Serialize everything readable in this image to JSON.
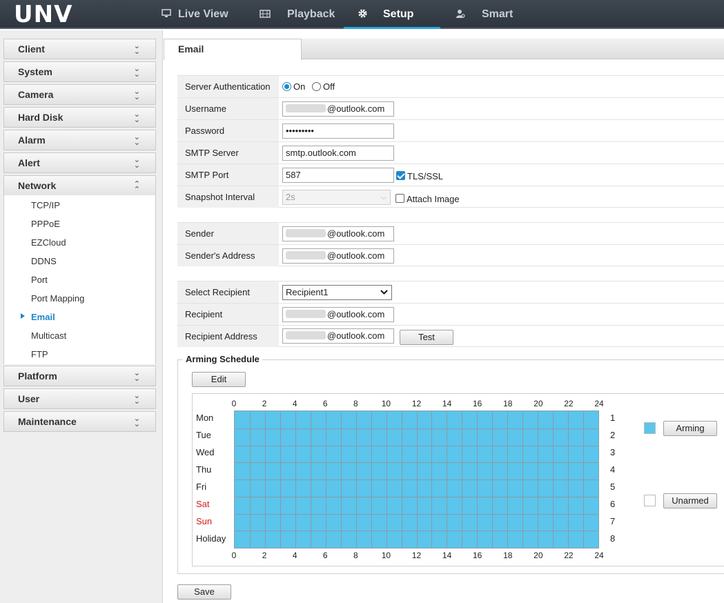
{
  "brand": {
    "logo_text": "UNV"
  },
  "topnav": {
    "tabs": [
      {
        "label": "Live View",
        "icon": "monitor-icon"
      },
      {
        "label": "Playback",
        "icon": "film-icon"
      },
      {
        "label": "Setup",
        "icon": "gear-icon",
        "active": true
      },
      {
        "label": "Smart",
        "icon": "person-search-icon"
      }
    ]
  },
  "sidebar": {
    "groups": [
      {
        "label": "Client"
      },
      {
        "label": "System"
      },
      {
        "label": "Camera"
      },
      {
        "label": "Hard Disk"
      },
      {
        "label": "Alarm"
      },
      {
        "label": "Alert"
      },
      {
        "label": "Network",
        "expanded": true
      },
      {
        "label": "Platform"
      },
      {
        "label": "User"
      },
      {
        "label": "Maintenance"
      }
    ],
    "network_items": [
      "TCP/IP",
      "PPPoE",
      "EZCloud",
      "DDNS",
      "Port",
      "Port Mapping",
      "Email",
      "Multicast",
      "FTP"
    ],
    "active_item": "Email"
  },
  "page": {
    "tab_title": "Email"
  },
  "form": {
    "server_auth": {
      "label": "Server Authentication",
      "on_label": "On",
      "off_label": "Off",
      "value": "On"
    },
    "username": {
      "label": "Username",
      "value_suffix": "@outlook.com"
    },
    "password": {
      "label": "Password",
      "value": "•••••••••"
    },
    "smtp_server": {
      "label": "SMTP Server",
      "value": "smtp.outlook.com"
    },
    "smtp_port": {
      "label": "SMTP Port",
      "value": "587"
    },
    "tls": {
      "label": "TLS/SSL",
      "checked": true
    },
    "snapshot_interval": {
      "label": "Snapshot Interval",
      "value": "2s",
      "disabled": true
    },
    "attach_image": {
      "label": "Attach Image",
      "checked": false
    },
    "sender": {
      "label": "Sender",
      "value_suffix": "@outlook.com"
    },
    "sender_address": {
      "label": "Sender's Address",
      "value_suffix": "@outlook.com"
    },
    "select_recipient": {
      "label": "Select Recipient",
      "value": "Recipient1"
    },
    "recipient": {
      "label": "Recipient",
      "value_suffix": "@outlook.com"
    },
    "recipient_address": {
      "label": "Recipient Address",
      "value_suffix": "@outlook.com"
    },
    "test_button": "Test"
  },
  "schedule": {
    "title": "Arming Schedule",
    "edit_button": "Edit",
    "days": [
      {
        "label": "Mon",
        "index": "1",
        "weekend": false
      },
      {
        "label": "Tue",
        "index": "2",
        "weekend": false
      },
      {
        "label": "Wed",
        "index": "3",
        "weekend": false
      },
      {
        "label": "Thu",
        "index": "4",
        "weekend": false
      },
      {
        "label": "Fri",
        "index": "5",
        "weekend": false
      },
      {
        "label": "Sat",
        "index": "6",
        "weekend": true
      },
      {
        "label": "Sun",
        "index": "7",
        "weekend": true
      },
      {
        "label": "Holiday",
        "index": "8",
        "weekend": false
      }
    ],
    "hour_labels": [
      "0",
      "2",
      "4",
      "6",
      "8",
      "10",
      "12",
      "14",
      "16",
      "18",
      "20",
      "22",
      "24"
    ],
    "all_armed": true,
    "arming_button": "Arming",
    "unarmed_button": "Unarmed",
    "arming_color": "#5bc5ec",
    "unarmed_color": "#ffffff"
  },
  "save_button": "Save"
}
